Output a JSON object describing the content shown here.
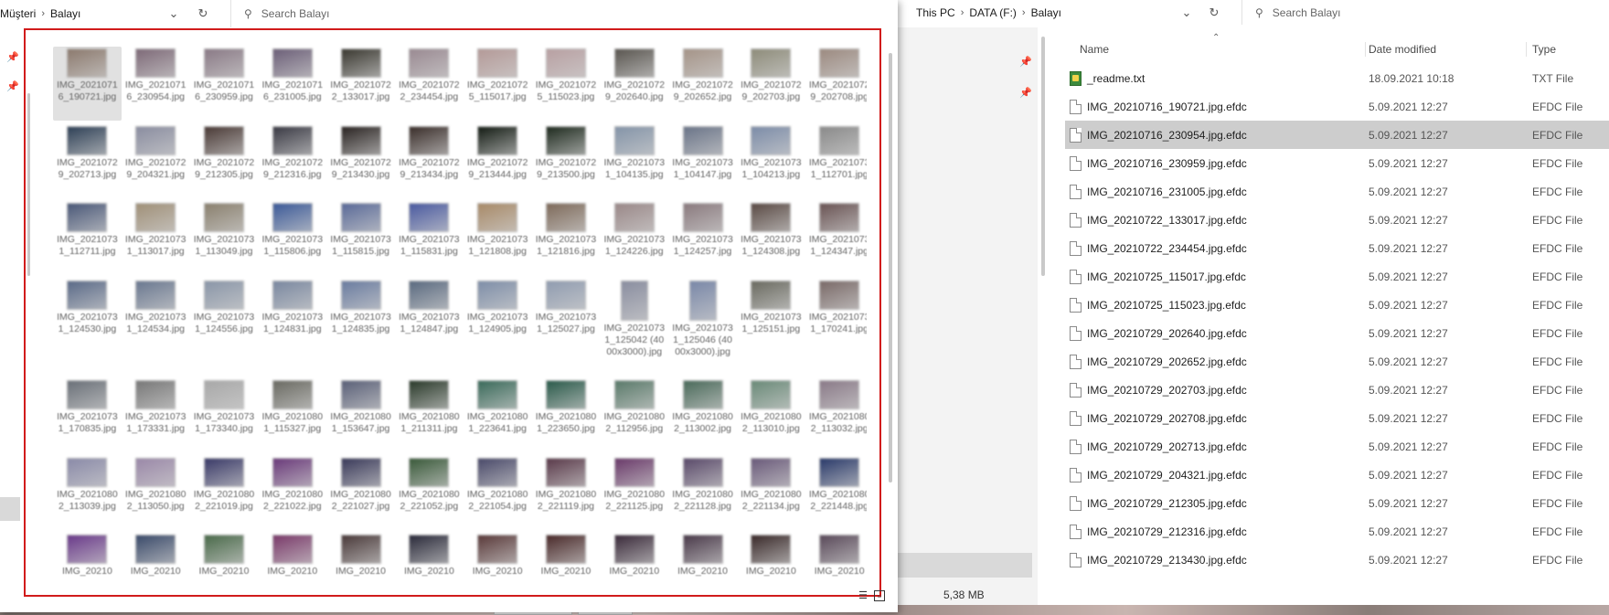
{
  "left_window": {
    "breadcrumb": [
      "Müşteri",
      "Balayı"
    ],
    "search_placeholder": "Search Balayı",
    "thumbnails": [
      {
        "label": "IMG_20210716_190721.jpg",
        "color": "#8c7a6e",
        "selected": true
      },
      {
        "label": "IMG_20210716_230954.jpg",
        "color": "#7e6a78"
      },
      {
        "label": "IMG_20210716_230959.jpg",
        "color": "#8a7a86"
      },
      {
        "label": "IMG_20210716_231005.jpg",
        "color": "#6c5f78"
      },
      {
        "label": "IMG_20210722_133017.jpg",
        "color": "#3a3830"
      },
      {
        "label": "IMG_20210722_234454.jpg",
        "color": "#9a8a92"
      },
      {
        "label": "IMG_20210725_115017.jpg",
        "color": "#b49a98"
      },
      {
        "label": "IMG_20210725_115023.jpg",
        "color": "#b8a0a2"
      },
      {
        "label": "IMG_20210729_202640.jpg",
        "color": "#5a5650"
      },
      {
        "label": "IMG_20210729_202652.jpg",
        "color": "#a59488"
      },
      {
        "label": "IMG_20210729_202703.jpg",
        "color": "#8e8c7a"
      },
      {
        "label": "IMG_20210729_202708.jpg",
        "color": "#9c8a80"
      },
      {
        "label": "IMG_20210729_202713.jpg",
        "color": "#2e4056"
      },
      {
        "label": "IMG_20210729_204321.jpg",
        "color": "#8a8da0"
      },
      {
        "label": "IMG_20210729_212305.jpg",
        "color": "#4a3a36"
      },
      {
        "label": "IMG_20210729_212316.jpg",
        "color": "#3a3a44"
      },
      {
        "label": "IMG_20210729_213430.jpg",
        "color": "#2a2422"
      },
      {
        "label": "IMG_20210729_213434.jpg",
        "color": "#3a2e2a"
      },
      {
        "label": "IMG_20210729_213444.jpg",
        "color": "#141c14"
      },
      {
        "label": "IMG_20210729_213500.jpg",
        "color": "#1e2a1e"
      },
      {
        "label": "IMG_20210731_104135.jpg",
        "color": "#8494a8"
      },
      {
        "label": "IMG_20210731_104147.jpg",
        "color": "#6a7488"
      },
      {
        "label": "IMG_20210731_104213.jpg",
        "color": "#7c8ca8"
      },
      {
        "label": "IMG_20210731_112701.jpg",
        "color": "#8a8a8a"
      },
      {
        "label": "IMG_20210731_112711.jpg",
        "color": "#4a5878"
      },
      {
        "label": "IMG_20210731_113017.jpg",
        "color": "#a09078"
      },
      {
        "label": "IMG_20210731_113049.jpg",
        "color": "#8a806e"
      },
      {
        "label": "IMG_20210731_115806.jpg",
        "color": "#3c5a98"
      },
      {
        "label": "IMG_20210731_115815.jpg",
        "color": "#5a6a98"
      },
      {
        "label": "IMG_20210731_115831.jpg",
        "color": "#4a5aa0"
      },
      {
        "label": "IMG_20210731_121808.jpg",
        "color": "#a88a68"
      },
      {
        "label": "IMG_20210731_121816.jpg",
        "color": "#7e6a5a"
      },
      {
        "label": "IMG_20210731_124226.jpg",
        "color": "#9a8888"
      },
      {
        "label": "IMG_20210731_124257.jpg",
        "color": "#8a7a7e"
      },
      {
        "label": "IMG_20210731_124308.jpg",
        "color": "#5a4a44"
      },
      {
        "label": "IMG_20210731_124347.jpg",
        "color": "#6a5454"
      },
      {
        "label": "IMG_20210731_124530.jpg",
        "color": "#5a6a88"
      },
      {
        "label": "IMG_20210731_124534.jpg",
        "color": "#6a7890"
      },
      {
        "label": "IMG_20210731_124556.jpg",
        "color": "#8a96a8"
      },
      {
        "label": "IMG_20210731_124831.jpg",
        "color": "#7a88a0"
      },
      {
        "label": "IMG_20210731_124835.jpg",
        "color": "#6a7ca0"
      },
      {
        "label": "IMG_20210731_124847.jpg",
        "color": "#5a6a80"
      },
      {
        "label": "IMG_20210731_124905.jpg",
        "color": "#7e8ea8"
      },
      {
        "label": "IMG_20210731_125027.jpg",
        "color": "#909cb0"
      },
      {
        "label": "IMG_20210731_125042 (4000x3000).jpg",
        "color": "#8a8ea0",
        "tall": true
      },
      {
        "label": "IMG_20210731_125046 (4000x3000).jpg",
        "color": "#7a88a8",
        "tall": true
      },
      {
        "label": "IMG_20210731_125151.jpg",
        "color": "#6a6a60"
      },
      {
        "label": "IMG_20210731_170241.jpg",
        "color": "#7a6a68"
      },
      {
        "label": "IMG_20210731_170835.jpg",
        "color": "#6a7078"
      },
      {
        "label": "IMG_20210731_173331.jpg",
        "color": "#787878"
      },
      {
        "label": "IMG_20210731_173340.jpg",
        "color": "#a8a8a8"
      },
      {
        "label": "IMG_20210801_115327.jpg",
        "color": "#6a6a62"
      },
      {
        "label": "IMG_20210801_153647.jpg",
        "color": "#5a6078"
      },
      {
        "label": "IMG_20210801_211311.jpg",
        "color": "#2a3a2a"
      },
      {
        "label": "IMG_20210801_223641.jpg",
        "color": "#3a6a5a"
      },
      {
        "label": "IMG_20210801_223650.jpg",
        "color": "#2a5a4a"
      },
      {
        "label": "IMG_20210802_112956.jpg",
        "color": "#5a7a6a"
      },
      {
        "label": "IMG_20210802_113002.jpg",
        "color": "#4a6a5a"
      },
      {
        "label": "IMG_20210802_113010.jpg",
        "color": "#6a8a78"
      },
      {
        "label": "IMG_20210802_113032.jpg",
        "color": "#8a7a88"
      },
      {
        "label": "IMG_20210802_113039.jpg",
        "color": "#8a8aa8"
      },
      {
        "label": "IMG_20210802_113050.jpg",
        "color": "#9a88a8"
      },
      {
        "label": "IMG_20210802_221019.jpg",
        "color": "#3a3a68"
      },
      {
        "label": "IMG_20210802_221022.jpg",
        "color": "#6a3a7a"
      },
      {
        "label": "IMG_20210802_221027.jpg",
        "color": "#3a3a5a"
      },
      {
        "label": "IMG_20210802_221052.jpg",
        "color": "#3a5a3a"
      },
      {
        "label": "IMG_20210802_221054.jpg",
        "color": "#4a4a6a"
      },
      {
        "label": "IMG_20210802_221119.jpg",
        "color": "#5a3a4a"
      },
      {
        "label": "IMG_20210802_221125.jpg",
        "color": "#6a3a6a"
      },
      {
        "label": "IMG_20210802_221128.jpg",
        "color": "#5a4a6a"
      },
      {
        "label": "IMG_20210802_221134.jpg",
        "color": "#6a5a7a"
      },
      {
        "label": "IMG_20210802_221448.jpg",
        "color": "#2a3a6a"
      },
      {
        "label": "IMG_20210",
        "color": "#6a3a8a"
      },
      {
        "label": "IMG_20210",
        "color": "#3a4a6a"
      },
      {
        "label": "IMG_20210",
        "color": "#4a6a4a"
      },
      {
        "label": "IMG_20210",
        "color": "#7a3a6a"
      },
      {
        "label": "IMG_20210",
        "color": "#4a3a3a"
      },
      {
        "label": "IMG_20210",
        "color": "#2a2a3a"
      },
      {
        "label": "IMG_20210",
        "color": "#5a3a3a"
      },
      {
        "label": "IMG_20210",
        "color": "#4a2a2a"
      },
      {
        "label": "IMG_20210",
        "color": "#3a2a3a"
      },
      {
        "label": "IMG_20210",
        "color": "#4a3a4a"
      },
      {
        "label": "IMG_20210",
        "color": "#3a2a2a"
      },
      {
        "label": "IMG_20210",
        "color": "#5a4a5a"
      }
    ],
    "highlight_color": "#d11b1b"
  },
  "right_window": {
    "breadcrumb": [
      "This PC",
      "DATA (F:)",
      "Balayı"
    ],
    "search_placeholder": "Search Balayı",
    "columns": {
      "name": "Name",
      "date": "Date modified",
      "type": "Type"
    },
    "files": [
      {
        "name": "_readme.txt",
        "date": "18.09.2021 10:18",
        "type": "TXT File",
        "icon": "text-file-icon"
      },
      {
        "name": "IMG_20210716_190721.jpg.efdc",
        "date": "5.09.2021 12:27",
        "type": "EFDC File",
        "icon": "file-icon"
      },
      {
        "name": "IMG_20210716_230954.jpg.efdc",
        "date": "5.09.2021 12:27",
        "type": "EFDC File",
        "icon": "file-icon",
        "selected": true
      },
      {
        "name": "IMG_20210716_230959.jpg.efdc",
        "date": "5.09.2021 12:27",
        "type": "EFDC File",
        "icon": "file-icon"
      },
      {
        "name": "IMG_20210716_231005.jpg.efdc",
        "date": "5.09.2021 12:27",
        "type": "EFDC File",
        "icon": "file-icon"
      },
      {
        "name": "IMG_20210722_133017.jpg.efdc",
        "date": "5.09.2021 12:27",
        "type": "EFDC File",
        "icon": "file-icon"
      },
      {
        "name": "IMG_20210722_234454.jpg.efdc",
        "date": "5.09.2021 12:27",
        "type": "EFDC File",
        "icon": "file-icon"
      },
      {
        "name": "IMG_20210725_115017.jpg.efdc",
        "date": "5.09.2021 12:27",
        "type": "EFDC File",
        "icon": "file-icon"
      },
      {
        "name": "IMG_20210725_115023.jpg.efdc",
        "date": "5.09.2021 12:27",
        "type": "EFDC File",
        "icon": "file-icon"
      },
      {
        "name": "IMG_20210729_202640.jpg.efdc",
        "date": "5.09.2021 12:27",
        "type": "EFDC File",
        "icon": "file-icon"
      },
      {
        "name": "IMG_20210729_202652.jpg.efdc",
        "date": "5.09.2021 12:27",
        "type": "EFDC File",
        "icon": "file-icon"
      },
      {
        "name": "IMG_20210729_202703.jpg.efdc",
        "date": "5.09.2021 12:27",
        "type": "EFDC File",
        "icon": "file-icon"
      },
      {
        "name": "IMG_20210729_202708.jpg.efdc",
        "date": "5.09.2021 12:27",
        "type": "EFDC File",
        "icon": "file-icon"
      },
      {
        "name": "IMG_20210729_202713.jpg.efdc",
        "date": "5.09.2021 12:27",
        "type": "EFDC File",
        "icon": "file-icon"
      },
      {
        "name": "IMG_20210729_204321.jpg.efdc",
        "date": "5.09.2021 12:27",
        "type": "EFDC File",
        "icon": "file-icon"
      },
      {
        "name": "IMG_20210729_212305.jpg.efdc",
        "date": "5.09.2021 12:27",
        "type": "EFDC File",
        "icon": "file-icon"
      },
      {
        "name": "IMG_20210729_212316.jpg.efdc",
        "date": "5.09.2021 12:27",
        "type": "EFDC File",
        "icon": "file-icon"
      },
      {
        "name": "IMG_20210729_213430.jpg.efdc",
        "date": "5.09.2021 12:27",
        "type": "EFDC File",
        "icon": "file-icon"
      }
    ],
    "status_text": "5,38 MB"
  }
}
